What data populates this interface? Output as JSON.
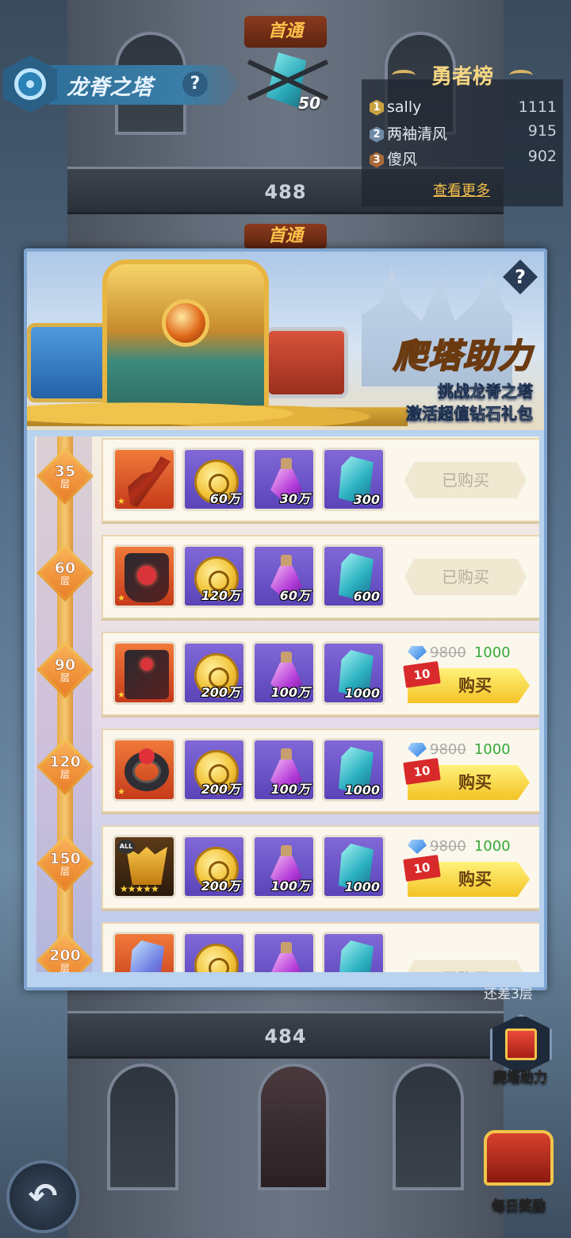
{
  "header": {
    "title": "龙脊之塔",
    "help": "?",
    "first_pass": "首通",
    "chained_reward_count": "50"
  },
  "leaderboard": {
    "title": "勇者榜",
    "entries": [
      {
        "rank": "1",
        "name": "sally",
        "score": "1111"
      },
      {
        "rank": "2",
        "name": "两袖清风",
        "score": "915"
      },
      {
        "rank": "3",
        "name": "傻风",
        "score": "902"
      }
    ],
    "see_more": "查看更多"
  },
  "tower": {
    "floor_top": "488",
    "first_pass_lower": "首通",
    "floor_bottom": "484",
    "remaining": "还差3层"
  },
  "panel": {
    "help": "?",
    "title": "爬塔助力",
    "subtitle_1": "挑战龙脊之塔",
    "subtitle_2": "激活超值钻石礼包",
    "tiers": [
      {
        "floor": "35",
        "unit": "层",
        "items": [
          "",
          "60万",
          "30万",
          "300"
        ],
        "status": "已购买"
      },
      {
        "floor": "60",
        "unit": "层",
        "items": [
          "",
          "120万",
          "60万",
          "600"
        ],
        "status": "已购买"
      },
      {
        "floor": "90",
        "unit": "层",
        "items": [
          "",
          "200万",
          "100万",
          "1000"
        ],
        "old_price": "9800",
        "new_price": "1000",
        "discount": "10",
        "buy": "购买"
      },
      {
        "floor": "120",
        "unit": "层",
        "items": [
          "",
          "200万",
          "100万",
          "1000"
        ],
        "old_price": "9800",
        "new_price": "1000",
        "discount": "10",
        "buy": "购买"
      },
      {
        "floor": "150",
        "unit": "层",
        "items": [
          "",
          "200万",
          "100万",
          "1000"
        ],
        "old_price": "9800",
        "new_price": "1000",
        "discount": "10",
        "buy": "购买"
      },
      {
        "floor": "200",
        "unit": "层",
        "items": [
          "",
          "",
          "",
          ""
        ],
        "status": "已购买"
      }
    ]
  },
  "side": {
    "climb_help": "爬塔助力",
    "daily_reward": "每日奖励"
  },
  "colors": {
    "accent_gold": "#f3c326",
    "price_green": "#35a93a",
    "discount_red": "#d82a2a"
  },
  "icons": {
    "back": "back-arrow-icon",
    "help": "question-icon",
    "diamond": "diamond-icon"
  }
}
